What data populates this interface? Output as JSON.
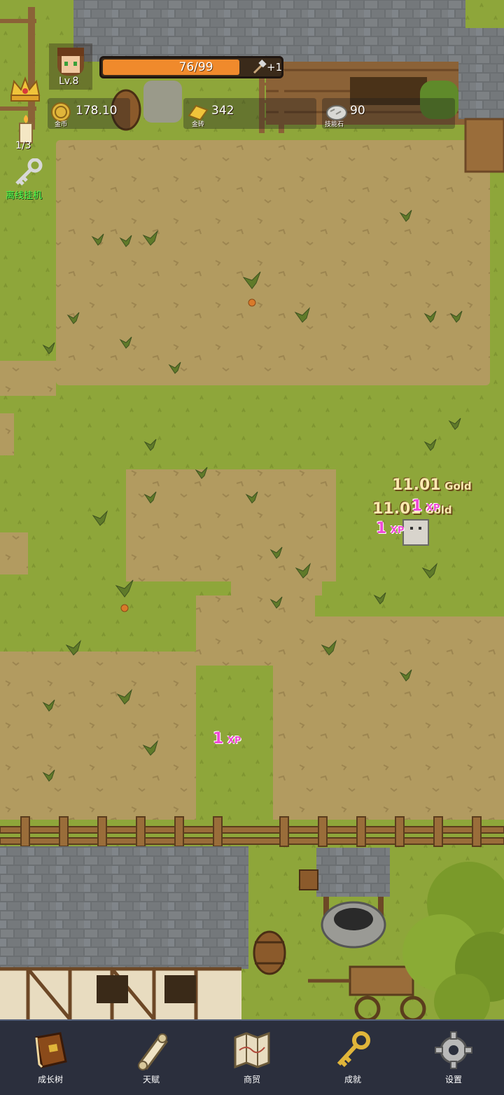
{
  "player": {
    "level": "Lv.8",
    "hp_text": "76/99",
    "hp_fraction": 0.77,
    "bonus": "+1"
  },
  "resources": [
    {
      "value": "178.10",
      "caption": "金币",
      "icon": "gold-coin-icon"
    },
    {
      "value": "342",
      "caption": "金砖",
      "icon": "gold-bar-icon"
    },
    {
      "value": "90",
      "caption": "技能石",
      "icon": "skill-stone-icon"
    }
  ],
  "left_panel": {
    "candle_count": "1/3",
    "afk_label": "离线挂机"
  },
  "floating": {
    "gold_1": {
      "amount": "11.01",
      "unit": "Gold"
    },
    "gold_2": {
      "amount": "11.01",
      "unit": "Gold"
    },
    "xp_1": {
      "amount": "1",
      "unit": "XP"
    },
    "xp_2": {
      "amount": "1",
      "unit": "XP"
    },
    "xp_3": {
      "amount": "1",
      "unit": "XP"
    }
  },
  "nav": [
    {
      "label": "成长树",
      "icon": "book-icon"
    },
    {
      "label": "天赋",
      "icon": "scroll-icon"
    },
    {
      "label": "商贸",
      "icon": "map-icon"
    },
    {
      "label": "成就",
      "icon": "key-icon"
    },
    {
      "label": "设置",
      "icon": "gear-icon"
    }
  ],
  "colors": {
    "grass": "#8fa83a",
    "dirt": "#b09a5f",
    "hp_bar": "#f08a2c",
    "nav_bg": "#2b2f3d",
    "xp_text": "#f04ad6",
    "gold_text": "#fbe9b0"
  }
}
